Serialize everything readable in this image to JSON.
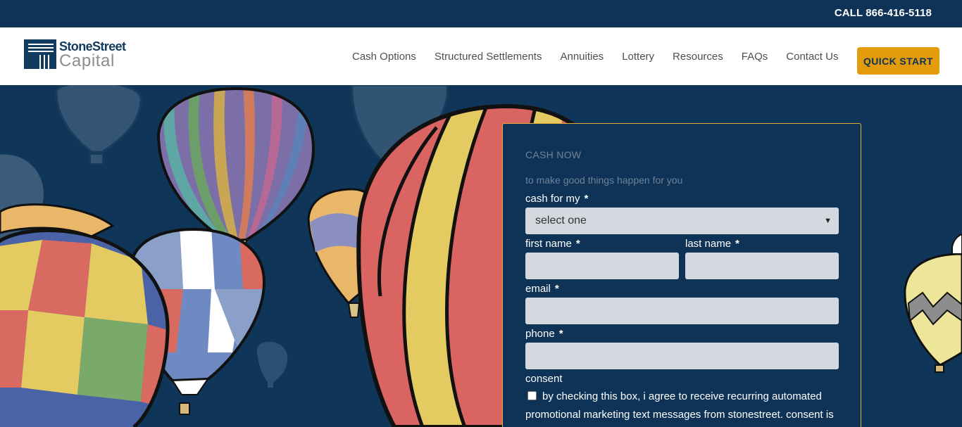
{
  "topbar": {
    "call_text": "CALL 866-416-5118"
  },
  "logo": {
    "word1": "StoneStreet",
    "word2": "Capital"
  },
  "nav": {
    "items": [
      "Cash Options",
      "Structured Settlements",
      "Annuities",
      "Lottery",
      "Resources",
      "FAQs",
      "Contact Us"
    ],
    "cta": "QUICK START"
  },
  "form": {
    "kicker": "CASH NOW",
    "subtitle": "to make good things happen for you",
    "cash_for_label": "cash for my",
    "cash_for_value": "select one",
    "first_name_label": "first name",
    "last_name_label": "last name",
    "email_label": "email",
    "phone_label": "phone",
    "consent_label": "consent",
    "consent_text": "by checking this box, i agree to receive recurring automated promotional marketing text messages from stonestreet. consent is",
    "required_mark": "*"
  },
  "colors": {
    "navy": "#0e3356",
    "accent": "#e39b0c",
    "field": "#d4d8df"
  },
  "icons": {
    "select_arrow": "chevron-down-icon"
  }
}
